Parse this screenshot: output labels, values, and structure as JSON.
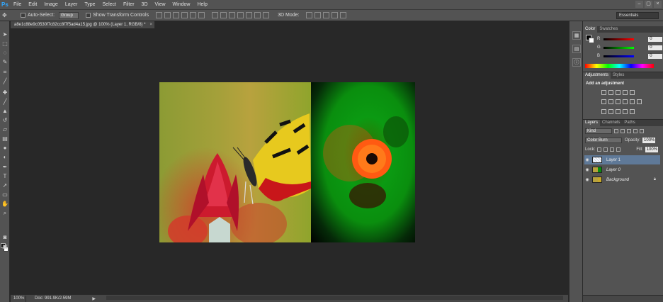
{
  "app": {
    "logo": "Ps"
  },
  "menu": [
    "File",
    "Edit",
    "Image",
    "Layer",
    "Type",
    "Select",
    "Filter",
    "3D",
    "View",
    "Window",
    "Help"
  ],
  "window_buttons": [
    "–",
    "▢",
    "×"
  ],
  "options": {
    "auto_select_label": "Auto-Select:",
    "auto_select_value": "Group",
    "show_transform_label": "Show Transform Controls",
    "mode_3d_label": "3D Mode:",
    "workspace": "Essentials"
  },
  "document": {
    "tab_title": "a8e1c88e9c0530f7c82cc8f7f5ad4a15.jpg @ 100% (Layer 1, RGB/8) *",
    "tab_close": "×"
  },
  "status": {
    "zoom": "100%",
    "doc_info": "Doc: 991.9K/2.59M",
    "arrow": "▶"
  },
  "color_panel": {
    "tabs": [
      "Color",
      "Swatches"
    ],
    "channels": [
      {
        "name": "R",
        "value": "0",
        "color": "#e03a3a"
      },
      {
        "name": "G",
        "value": "0",
        "color": "#2fbf3a"
      },
      {
        "name": "B",
        "value": "0",
        "color": "#3a5ae0"
      }
    ]
  },
  "adjustments": {
    "tabs": [
      "Adjustments",
      "Styles"
    ],
    "title": "Add an adjustment"
  },
  "layers_panel": {
    "tabs": [
      "Layers",
      "Channels",
      "Paths"
    ],
    "filter_kind": "Kind",
    "blend_mode": "Color Burn",
    "opacity_label": "Opacity:",
    "opacity_value": "100%",
    "lock_label": "Lock:",
    "fill_label": "Fill:",
    "fill_value": "100%",
    "layers": [
      {
        "name": "Layer 1",
        "selected": true
      },
      {
        "name": "Layer 0",
        "selected": false
      },
      {
        "name": "Background",
        "selected": false,
        "locked": true
      }
    ]
  }
}
